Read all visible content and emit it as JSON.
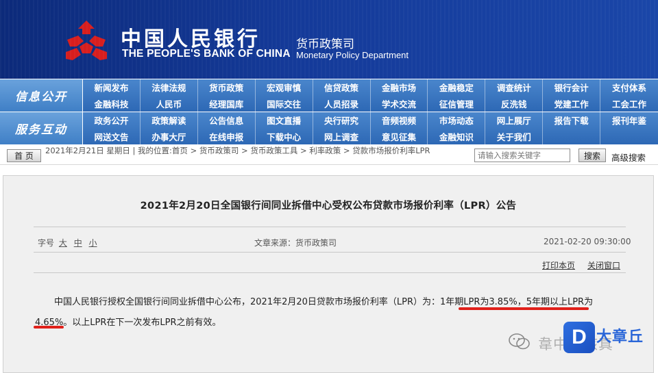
{
  "header": {
    "bank_name_cn": "中国人民银行",
    "bank_name_en": "THE PEOPLE'S BANK OF CHINA",
    "dept_cn": "货币政策司",
    "dept_en": "Monetary Policy Department"
  },
  "nav": {
    "block1_label": "信息公开",
    "block2_label": "服务互动",
    "block1_items": [
      "新闻发布",
      "法律法规",
      "货币政策",
      "宏观审慎",
      "信贷政策",
      "金融市场",
      "金融稳定",
      "调查统计",
      "银行会计",
      "支付体系",
      "金融科技",
      "人民币",
      "经理国库",
      "国际交往",
      "人员招录",
      "学术交流",
      "征信管理",
      "反洗钱",
      "党建工作",
      "工会工作"
    ],
    "block2_items": [
      "政务公开",
      "政策解读",
      "公告信息",
      "图文直播",
      "央行研究",
      "音频视频",
      "市场动态",
      "网上展厅",
      "报告下载",
      "报刊年鉴",
      "网送文告",
      "办事大厅",
      "在线申报",
      "下载中心",
      "网上调查",
      "意见征集",
      "金融知识",
      "关于我们",
      "",
      ""
    ]
  },
  "crumbs": {
    "home_label": "首 页",
    "text": "2021年2月21日 星期日 | 我的位置:首页 > 货币政策司 > 货币政策工具 > 利率政策 > 贷款市场报价利率LPR",
    "search_placeholder": "请输入搜索关键字",
    "search_label": "搜索",
    "advanced_search": "高级搜索"
  },
  "article": {
    "title": "2021年2月20日全国银行间同业拆借中心受权公布贷款市场报价利率（LPR）公告",
    "font_size_label": "字号",
    "font_sizes": [
      "大",
      "中",
      "小"
    ],
    "source": "文章来源：货币政策司",
    "time": "2021-02-20 09:30:00",
    "print": "打印本页",
    "close": "关闭窗口",
    "body": "中国人民银行授权全国银行间同业拆借中心公布，2021年2月20日贷款市场报价利率（LPR）为：1年期LPR为3.85%，5年期以上LPR为4.65%。以上LPR在下一次发布LPR之前有效。"
  },
  "watermark": {
    "text": "韋中硬核真",
    "brand_letter": "D",
    "brand_name": "大章丘",
    "red_color": "#e0201a"
  }
}
